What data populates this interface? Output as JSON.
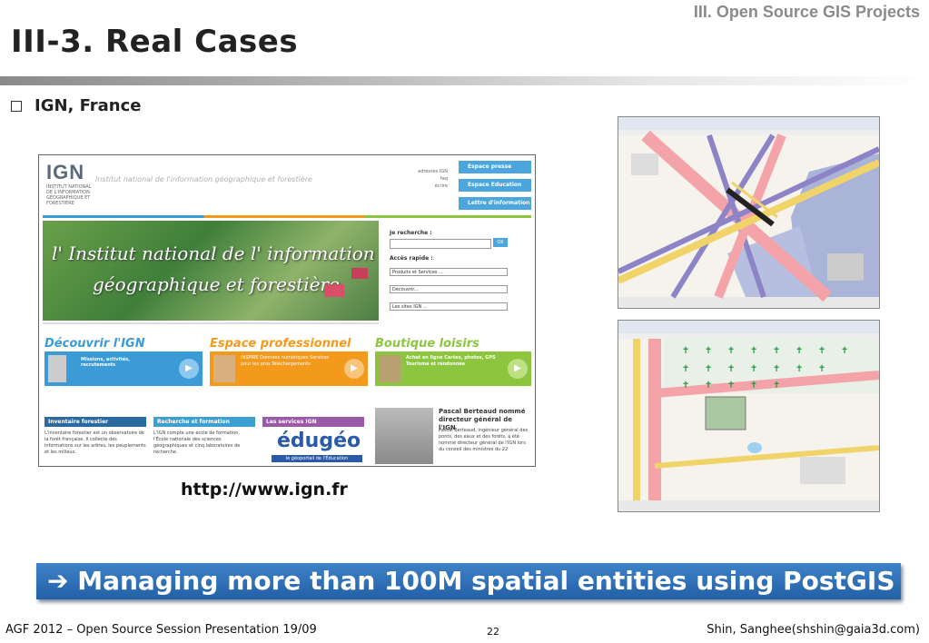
{
  "header": {
    "section": "III. Open Source GIS Projects",
    "title": "III-3. Real Cases",
    "bullet": "IGN, France"
  },
  "ign_site": {
    "logo": "IGN",
    "tagline": "Institut national de l'information géographique et forestière",
    "logo_sub": "INSTITUT NATIONAL DE L'INFORMATION GÉOGRAPHIQUE ET FORESTIÈRE",
    "top_links": [
      "adresses IGN",
      "faq",
      "écrire"
    ],
    "nav_buttons": [
      "Espace presse",
      "Espace Education",
      "Lettre d'information"
    ],
    "hero_line1": "l' Institut national de l' information",
    "hero_line2": "géographique et forestière",
    "search_label": "Je recherche :",
    "search_button": "OK",
    "quick_access_label": "Accès rapide :",
    "selects": [
      "Produits et Services ...",
      "Découvrir...",
      "Les sites IGN ..."
    ],
    "sections": [
      {
        "title": "Découvrir l'IGN",
        "text": "Missions, activités, recrutements",
        "color": "#3a9bd6"
      },
      {
        "title": "Espace professionnel",
        "text": "INSPIRE Données numériques Services pour les pros Téléchargements",
        "color": "#f39a1d"
      },
      {
        "title": "Boutique loisirs",
        "text": "Achat en ligne Cartes, photos, GPS Tourisme et randonnée",
        "color": "#8cc63e"
      }
    ],
    "tabs": [
      {
        "label": "Inventaire forestier",
        "text": "L'inventaire forestier est un observatoire de la forêt française. Il collecte des informations sur les arbres, les peuplements et les milieux.",
        "color": "#2a6aa0"
      },
      {
        "label": "Recherche et formation",
        "text": "L'IGN compte une école de formation, l'École nationale des sciences géographiques et cinq laboratoires de recherche.",
        "color": "#3d9fd0"
      },
      {
        "label": "Les services IGN",
        "text": "",
        "color": "#9a5aa8"
      }
    ],
    "edugeo": "édugéo",
    "edugeo_sub": "le géoportail de l'Éducation",
    "news_title": "Pascal Berteaud nommé directeur général de l'IGN",
    "news_text": "Pascal Berteaud, ingénieur général des ponts, des eaux et des forêts, a été nommé directeur général de l'IGN lors du conseil des ministres du 22"
  },
  "url": "http://www.ign.fr",
  "banner": "➔ Managing more than 100M spatial entities using PostGIS",
  "footer": {
    "left": "AGF 2012 – Open Source Session Presentation 19/09",
    "page": "22",
    "right": "Shin, Sanghee(shshin@gaia3d.com)"
  },
  "colors": {
    "banner": "#2e6fb7",
    "title_bar": "#8a8a8a"
  }
}
